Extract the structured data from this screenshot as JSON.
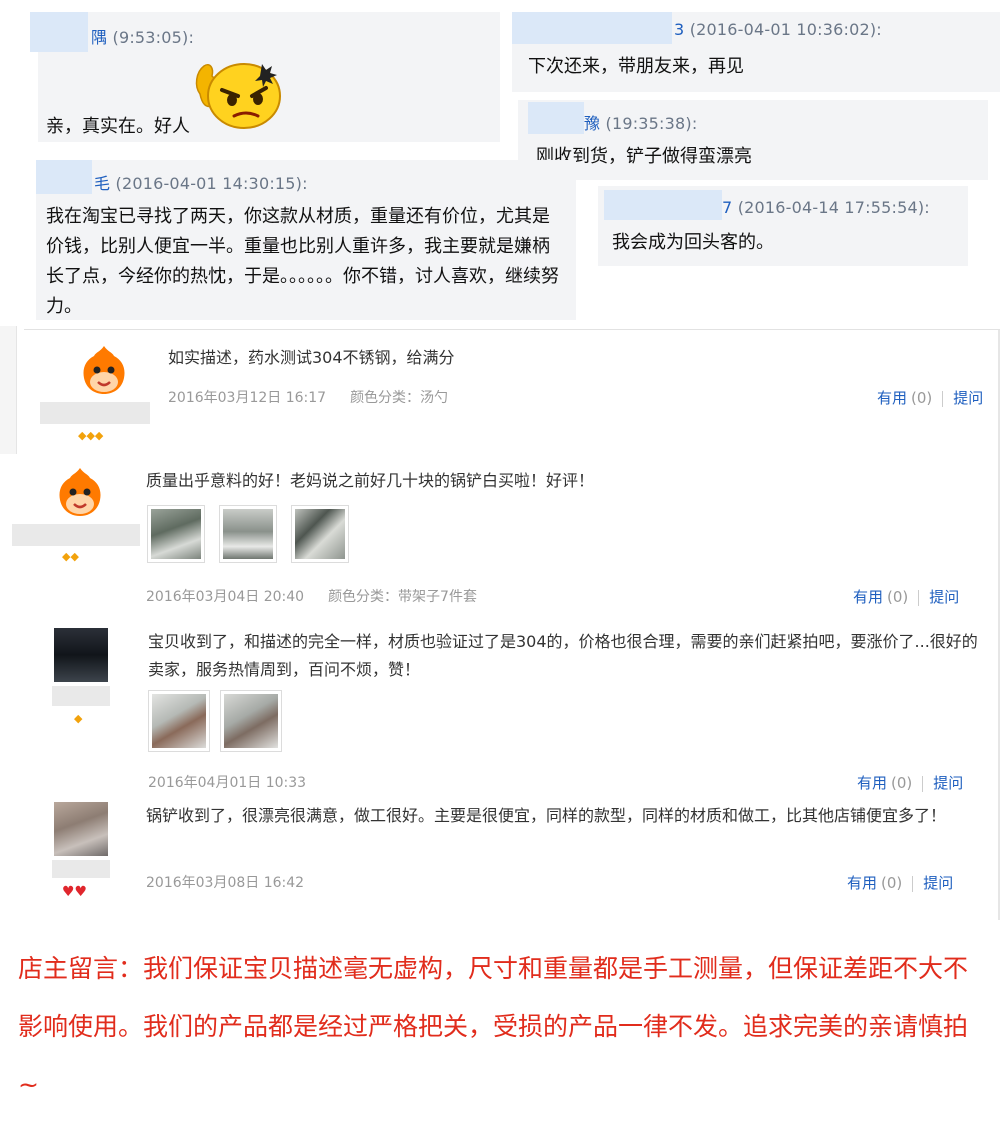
{
  "chats": [
    {
      "name": "隅",
      "time": "(9:53:05):",
      "message": "亲，真实在。好人",
      "emoji": "thumbs-up-angry-face-emoji"
    },
    {
      "name": "3",
      "time": "(2016-04-01 10:36:02):",
      "message": "下次还来，带朋友来，再见"
    },
    {
      "name": "豫",
      "time": "(19:35:38):",
      "message": "刚收到货，铲子做得蛮漂亮"
    },
    {
      "name": "毛",
      "time": "(2016-04-01 14:30:15):",
      "message": "我在淘宝已寻找了两天，你这款从材质，重量还有价位，尤其是价钱，比别人便宜一半。重量也比别人重许多，我主要就是嫌柄长了点，今经你的热忱，于是。。。。。。你不错，讨人喜欢，继续努力。"
    },
    {
      "name": "7",
      "time": "(2016-04-14 17:55:54):",
      "message": "我会成为回头客的。"
    }
  ],
  "reviews": [
    {
      "text": "如实描述，药水测试304不锈钢，给满分",
      "date": "2016年03月12日 16:17",
      "category": "颜色分类：汤勺",
      "useful_label": "有用",
      "useful_count": "(0)",
      "reply_label": "提问",
      "rank": "3 diamonds",
      "avatar": "orange-mascot"
    },
    {
      "text": "质量出乎意料的好！老妈说之前好几十块的锅铲白买啦！好评！",
      "date": "2016年03月04日 20:40",
      "category": "颜色分类：带架子7件套",
      "useful_label": "有用",
      "useful_count": "(0)",
      "reply_label": "提问",
      "rank": "2 diamonds",
      "avatar": "orange-mascot",
      "photos": 3
    },
    {
      "text": "宝贝收到了，和描述的完全一样，材质也验证过了是304的，价格也很合理，需要的亲们赶紧拍吧，要涨价了...很好的卖家，服务热情周到，百问不烦，赞！",
      "date": "2016年04月01日 10:33",
      "category": "",
      "useful_label": "有用",
      "useful_count": "(0)",
      "reply_label": "提问",
      "rank": "1 diamond",
      "avatar": "photo-dark",
      "photos": 2
    },
    {
      "text": "锅铲收到了，很漂亮很满意，做工很好。主要是很便宜，同样的款型，同样的材质和做工，比其他店铺便宜多了！",
      "date": "2016年03月08日 16:42",
      "category": "",
      "useful_label": "有用",
      "useful_count": "(0)",
      "reply_label": "提问",
      "rank": "2 hearts",
      "avatar": "photo-light"
    }
  ],
  "owner_note": "店主留言：我们保证宝贝描述毫无虚构，尺寸和重量都是手工测量，但保证差距不大不影响使用。我们的产品都是经过严格把关，受损的产品一律不发。追求完美的亲请慎拍~",
  "colors": {
    "link": "#1f5fbf",
    "owner_note": "#e12c1c",
    "gem": "#f2a20c",
    "heart": "#e0262d"
  }
}
